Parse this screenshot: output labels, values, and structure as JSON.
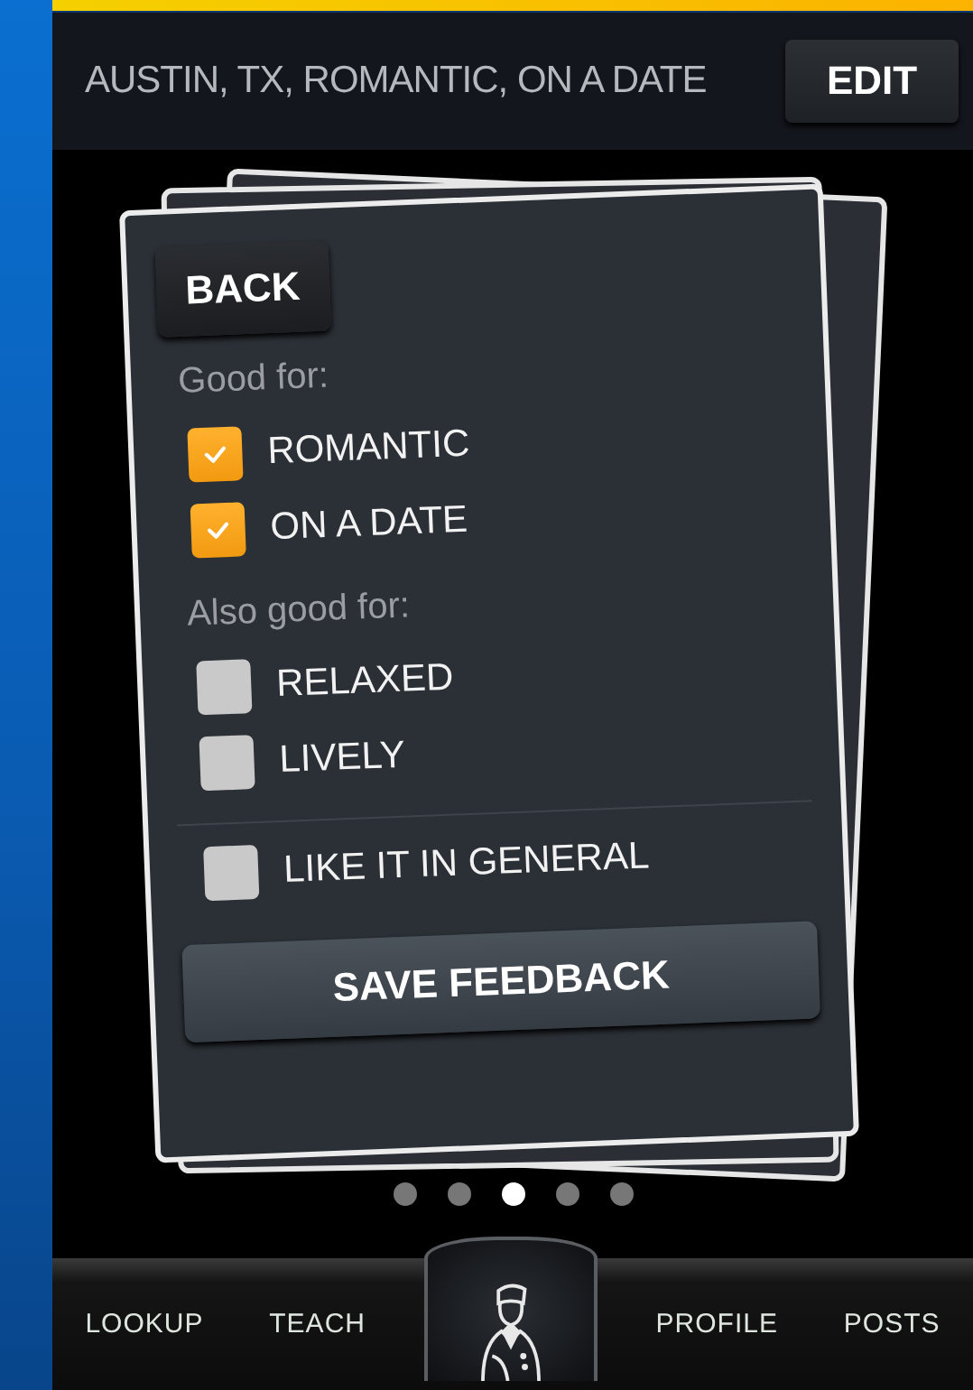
{
  "header": {
    "title": "AUSTIN, TX, ROMANTIC, ON A DATE",
    "edit_button": "EDIT"
  },
  "card": {
    "back_button": "BACK",
    "sections": [
      {
        "heading": "Good for:",
        "options": [
          {
            "label": "ROMANTIC",
            "checked": true
          },
          {
            "label": "ON A DATE",
            "checked": true
          }
        ]
      },
      {
        "heading": "Also good for:",
        "options": [
          {
            "label": "RELAXED",
            "checked": false
          },
          {
            "label": "LIVELY",
            "checked": false
          }
        ]
      }
    ],
    "general_option": {
      "label": "LIKE IT IN GENERAL",
      "checked": false
    },
    "save_button": "SAVE FEEDBACK"
  },
  "pager": [
    {
      "selected": false
    },
    {
      "selected": false
    },
    {
      "selected": true
    },
    {
      "selected": false
    },
    {
      "selected": false
    }
  ],
  "nav": [
    {
      "kind": "tab",
      "label": "LOOKUP"
    },
    {
      "kind": "tab",
      "label": "TEACH"
    },
    {
      "kind": "logo"
    },
    {
      "kind": "tab",
      "label": "PROFILE"
    },
    {
      "kind": "tab",
      "label": "POSTS"
    }
  ]
}
